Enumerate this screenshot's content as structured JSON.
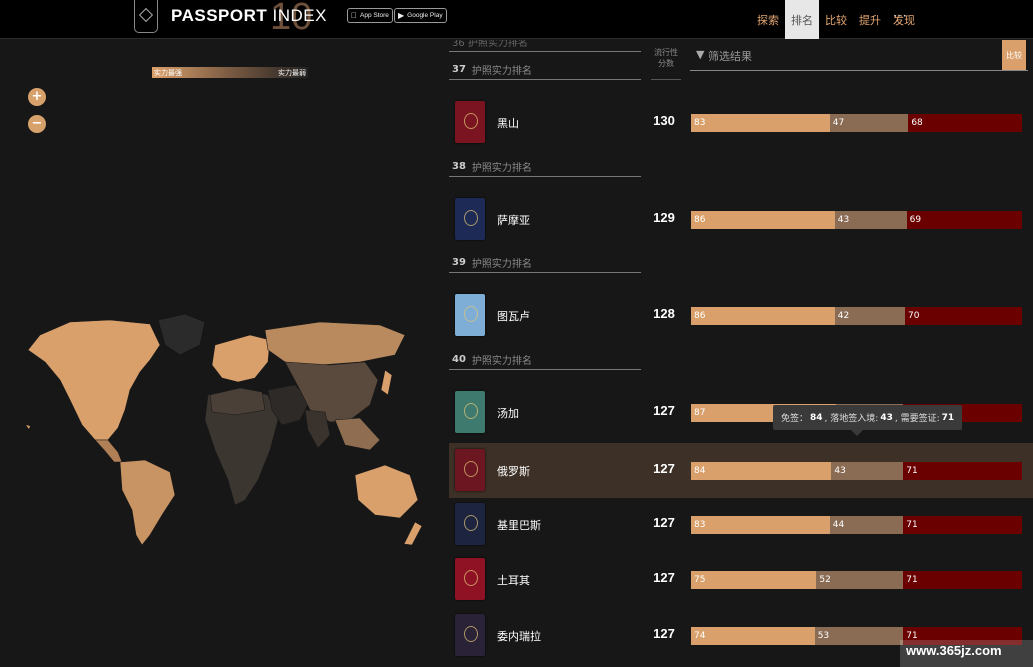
{
  "header": {
    "logo_bold": "PASSPORT",
    "logo_light": " INDEX",
    "logo_ten": "10",
    "app_store": "App Store",
    "google_play": "Google Play",
    "nav": [
      "探索",
      "排名",
      "比较",
      "提升",
      "发现"
    ],
    "nav_active_index": 1,
    "more": "···"
  },
  "map": {
    "legend_left": "实力最强",
    "legend_right": "实力最弱",
    "zoom_in": "+",
    "zoom_out": "−"
  },
  "filter": {
    "placeholder": "筛选结果",
    "compare": "比较"
  },
  "score_header": [
    "流行性",
    "分数"
  ],
  "list": {
    "cut_off_header": "36 护照实力排名",
    "rank_groups": [
      {
        "rank": "37",
        "label": "护照实力排名"
      },
      {
        "rank": "38",
        "label": "护照实力排名"
      },
      {
        "rank": "39",
        "label": "护照实力排名"
      },
      {
        "rank": "40",
        "label": "护照实力排名"
      }
    ],
    "rows": [
      {
        "country": "黑山",
        "score": "130",
        "visa_free": 83,
        "visa_on_arrival": 47,
        "visa_required": 68,
        "book_color": "#7a1420",
        "highlighted": false
      },
      {
        "country": "萨摩亚",
        "score": "129",
        "visa_free": 86,
        "visa_on_arrival": 43,
        "visa_required": 69,
        "book_color": "#1c2a55",
        "highlighted": false
      },
      {
        "country": "图瓦卢",
        "score": "128",
        "visa_free": 86,
        "visa_on_arrival": 42,
        "visa_required": 70,
        "book_color": "#7eaed6",
        "highlighted": false
      },
      {
        "country": "汤加",
        "score": "127",
        "visa_free": 87,
        "visa_on_arrival": 40,
        "visa_required": 71,
        "book_color": "#3f7a6e",
        "highlighted": false
      },
      {
        "country": "俄罗斯",
        "score": "127",
        "visa_free": 84,
        "visa_on_arrival": 43,
        "visa_required": 71,
        "book_color": "#6b1620",
        "highlighted": true
      },
      {
        "country": "基里巴斯",
        "score": "127",
        "visa_free": 83,
        "visa_on_arrival": 44,
        "visa_required": 71,
        "book_color": "#1c2440",
        "highlighted": false
      },
      {
        "country": "土耳其",
        "score": "127",
        "visa_free": 75,
        "visa_on_arrival": 52,
        "visa_required": 71,
        "book_color": "#8e1224",
        "highlighted": false
      },
      {
        "country": "委内瑞拉",
        "score": "127",
        "visa_free": 74,
        "visa_on_arrival": 53,
        "visa_required": 71,
        "book_color": "#2a2236",
        "highlighted": false
      }
    ]
  },
  "tooltip": {
    "vf_label": "免签：",
    "vf_value": "84",
    "voa_label": ", 落地签入境:",
    "voa_value": "43",
    "vr_label": ", 需要签证:",
    "vr_value": "71"
  },
  "colors": {
    "visa_free": "#d9a06c",
    "visa_on_arrival": "#8a6b54",
    "visa_required": "#6b0000",
    "accent": "#e5a774"
  },
  "watermark": "www.365jz.com"
}
